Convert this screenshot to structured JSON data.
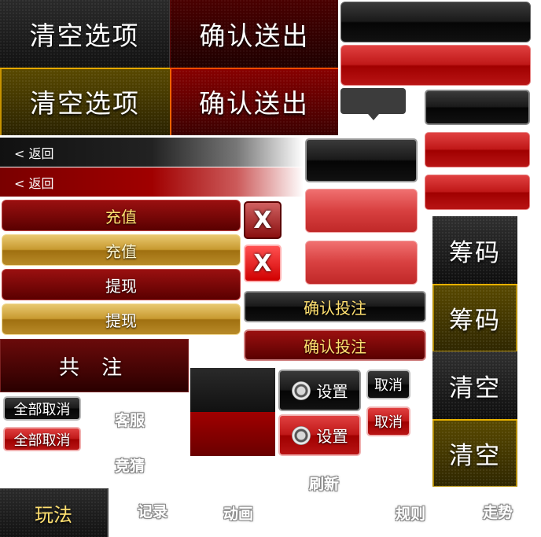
{
  "tiles_top": {
    "clear_label": "清空选项",
    "clear_label_gold": "清空选项",
    "confirm_label": "确认送出",
    "confirm_label_red": "确认送出"
  },
  "back_bars": {
    "back_dark_label": "< 返回",
    "back_red_label": "< 返回"
  },
  "recharge": {
    "red_label": "充值",
    "gold_label": "充值"
  },
  "withdraw": {
    "red_label": "提现",
    "gold_label": "提现"
  },
  "close_buttons": {
    "dark_symbol": "X",
    "bright_symbol": "X"
  },
  "bet": {
    "dark_label": "确认投注",
    "red_label": "确认投注"
  },
  "total": {
    "label": "共 注"
  },
  "cancel_all": {
    "dark_label": "全部取消",
    "red_label": "全部取消"
  },
  "settings": {
    "dark_label": "设置",
    "red_label": "设置"
  },
  "cancel": {
    "dark_label": "取消",
    "red_label": "取消"
  },
  "side_tiles": {
    "chips_dark": "筹码",
    "chips_gold": "筹码",
    "clear_dark": "清空",
    "clear_gold": "清空"
  },
  "ghost_labels": {
    "customer_service": "客服",
    "guess": "竞猜",
    "refresh": "刷新",
    "records": "记录",
    "animation": "动画",
    "rules": "规则",
    "trend": "走势"
  },
  "gameplay_tab": {
    "label": "玩法"
  },
  "colors": {
    "gold_text": "#ffe070",
    "dark_red": "#5a0000",
    "gold_border": "#e6a800"
  }
}
